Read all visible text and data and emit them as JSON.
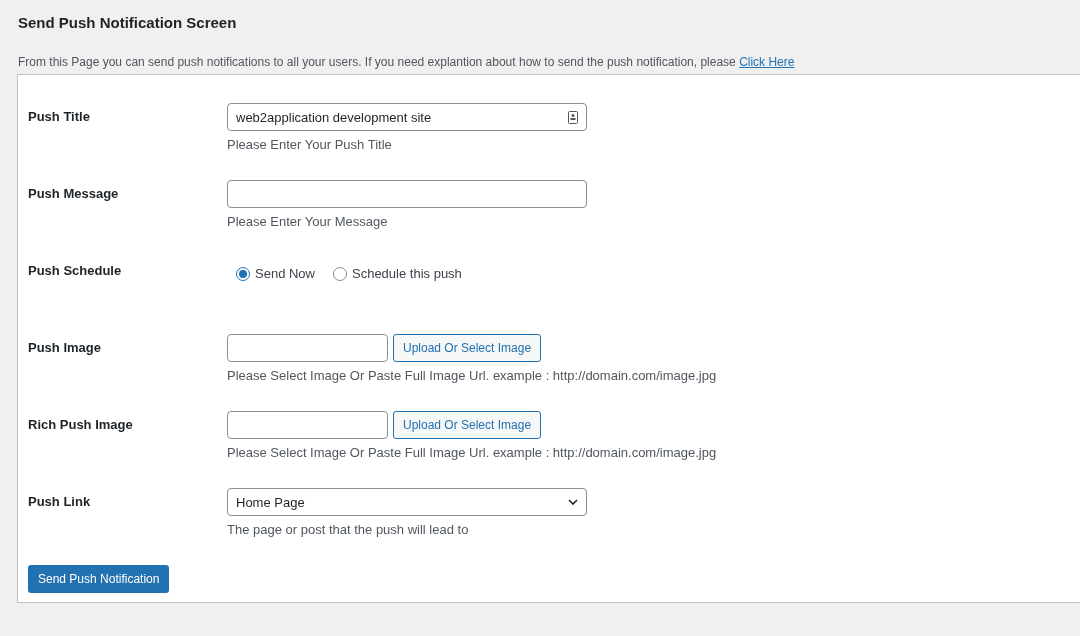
{
  "page": {
    "title": "Send Push Notification Screen",
    "description": "From this Page you can send push notifications to all your users. If you need explantion about how to send the push notification, please",
    "description_link": "Click Here"
  },
  "form": {
    "rows": [
      {
        "kind": "text",
        "label": "Push Title",
        "value": "web2application development site",
        "help": "Please Enter Your Push Title"
      },
      {
        "kind": "text",
        "label": "Push Message",
        "value": "",
        "help": "Please Enter Your Message"
      },
      {
        "kind": "radio",
        "label": "Push Schedule",
        "options": [
          {
            "label": "Send Now",
            "selected": true
          },
          {
            "label": "Schedule this push",
            "selected": false
          }
        ]
      },
      {
        "kind": "image",
        "label": "Push Image",
        "button": "Upload Or Select Image",
        "help": "Please Select Image Or Paste Full Image Url. example : http://domain.com/image.jpg"
      },
      {
        "kind": "image",
        "label": "Rich Push Image",
        "button": "Upload Or Select Image",
        "help": "Please Select Image Or Paste Full Image Url. example : http://domain.com/image.jpg"
      },
      {
        "kind": "select",
        "label": "Push Link",
        "value": "Home Page",
        "help": "The page or post that the push will lead to"
      }
    ],
    "submit": "Send Push Notification"
  }
}
